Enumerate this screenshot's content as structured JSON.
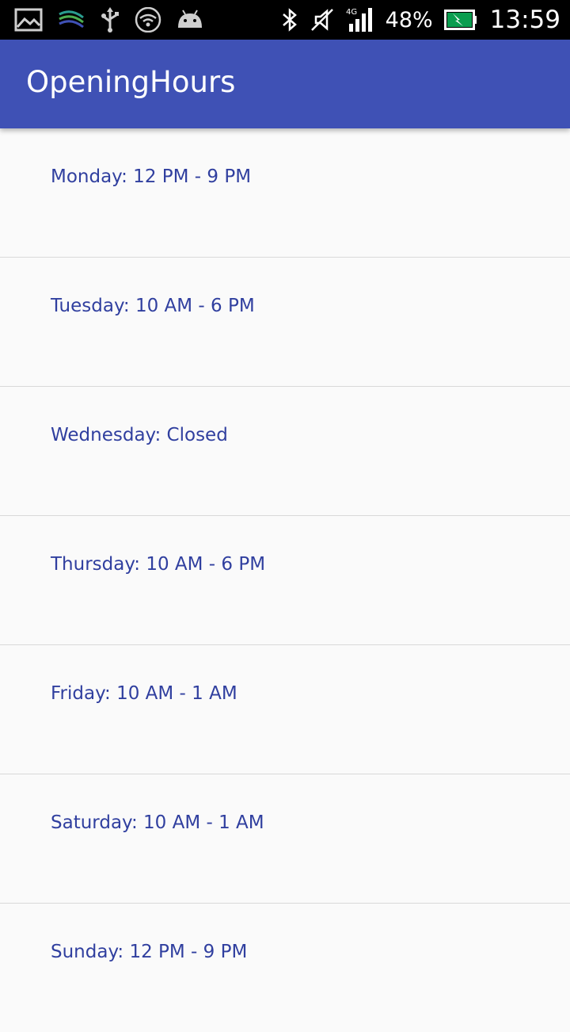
{
  "status_bar": {
    "battery_percent": "48%",
    "time": "13:59",
    "network_type": "4G",
    "icons": [
      "gallery-icon",
      "swiftkey-icon",
      "usb-icon",
      "wifi-icon",
      "android-icon",
      "bluetooth-icon",
      "silent-icon",
      "signal-icon",
      "battery-icon"
    ]
  },
  "app_bar": {
    "title": "OpeningHours",
    "color": "#3f51b5"
  },
  "hours": [
    {
      "text": "Monday: 12 PM - 9 PM"
    },
    {
      "text": "Tuesday: 10 AM - 6 PM"
    },
    {
      "text": "Wednesday: Closed"
    },
    {
      "text": "Thursday: 10 AM - 6 PM"
    },
    {
      "text": "Friday: 10 AM - 1 AM"
    },
    {
      "text": "Saturday: 10 AM - 1 AM"
    },
    {
      "text": "Sunday: 12 PM - 9 PM"
    }
  ],
  "colors": {
    "primary": "#3f51b5",
    "item_text": "#303f9f",
    "background": "#fafafa",
    "divider": "#d9d9d9"
  }
}
